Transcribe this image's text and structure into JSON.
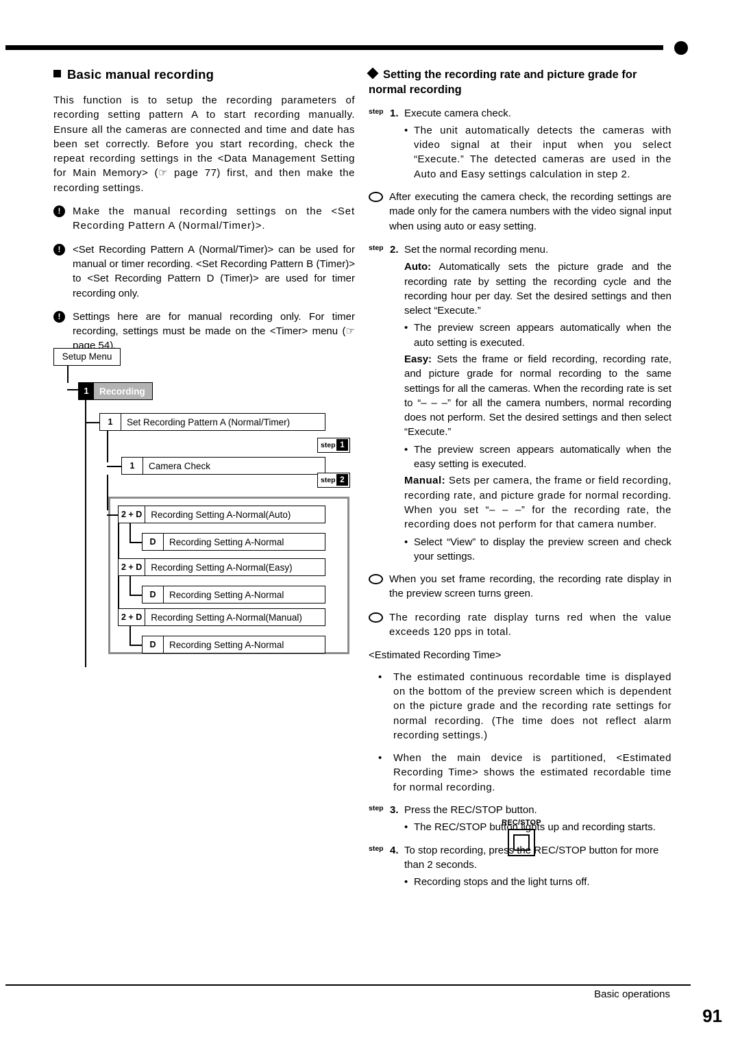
{
  "left": {
    "section_title": "Basic manual recording",
    "intro": "This function is to setup the recording parameters of recording setting pattern A to start recording manually. Ensure all the cameras are connected and time and date has been set correctly.  Before you start recording, check the repeat recording settings in the <Data Management Setting for Main Memory> (☞ page 77) first, and then make the recording settings.",
    "notes": [
      "Make the manual recording settings on the <Set Recording Pattern A (Normal/Timer)>.",
      "<Set Recording Pattern A (Normal/Timer)> can be used for manual or timer recording. <Set Recording Pattern B (Timer)> to <Set Recording Pattern D (Timer)> are used for timer recording only.",
      "Settings here are for manual recording only. For timer recording, settings must be made on the <Timer> menu (☞ page 54)."
    ],
    "diagram": {
      "setup_menu": "Setup Menu",
      "recording_tag": "1",
      "recording_label": "Recording",
      "rows": [
        {
          "tag": "1",
          "label": "Set Recording Pattern A (Normal/Timer)"
        },
        {
          "tag": "1",
          "label": "Camera Check"
        },
        {
          "tag": "2 + D",
          "label": "Recording Setting A-Normal(Auto)"
        },
        {
          "tag": "D",
          "label": "Recording Setting A-Normal"
        },
        {
          "tag": "2 + D",
          "label": "Recording Setting A-Normal(Easy)"
        },
        {
          "tag": "D",
          "label": "Recording Setting A-Normal"
        },
        {
          "tag": "2 + D",
          "label": "Recording Setting A-Normal(Manual)"
        },
        {
          "tag": "D",
          "label": "Recording Setting A-Normal"
        }
      ],
      "step_tags": [
        {
          "word": "step",
          "num": "1"
        },
        {
          "word": "step",
          "num": "2"
        }
      ]
    }
  },
  "right": {
    "section_title": "Setting the recording rate and picture grade for normal recording",
    "step1": {
      "tag": "step",
      "num": "1.",
      "text": "Execute camera check."
    },
    "step1_sub": "The unit automatically detects the cameras with video signal at their input when you select “Execute.” The detected cameras are used in the Auto and Easy settings calculation in step 2.",
    "hint1": "After executing the camera check, the recording settings are made only for the camera numbers with the video signal input when using auto or easy setting.",
    "step2": {
      "tag": "step",
      "num": "2.",
      "text": "Set the normal recording menu."
    },
    "auto_label": "Auto:",
    "auto_text": " Automatically sets the picture grade and the recording rate by setting the recording cycle and the recording hour per day. Set the desired settings and then select “Execute.”",
    "auto_sub": "The preview screen appears automatically when the auto setting is executed.",
    "easy_label": "Easy:",
    "easy_text": " Sets the frame or field recording, recording rate, and picture grade for normal recording to the same settings for all the cameras. When the recording rate is set to “– – –” for all the camera numbers, normal recording does not perform.  Set the desired settings and then select “Execute.”",
    "easy_sub": "The preview screen appears automatically when the easy setting is executed.",
    "manual_label": "Manual:",
    "manual_text": " Sets per camera, the frame or field recording, recording rate, and picture grade for normal recording. When you set “– – –” for the recording rate, the recording does not perform for that camera number.",
    "manual_sub": "Select “View” to display the preview screen and check your settings.",
    "hint2": "When you set frame recording, the recording rate display in the preview screen turns green.",
    "hint3": "The recording rate display turns red when the value exceeds 120 pps in total.",
    "estimated_title": "<Estimated Recording Time>",
    "estimated_items": [
      "The estimated continuous recordable time is displayed on the bottom of the preview screen which is dependent on the picture grade and the recording rate settings for normal recording. (The time does not reflect alarm recording settings.)",
      "When the main device is partitioned, <Estimated Recording Time> shows the estimated recordable time for normal recording."
    ],
    "step3": {
      "tag": "step",
      "num": "3.",
      "text": "Press the REC/STOP button."
    },
    "step3_sub": "The REC/STOP button lights up and recording starts.",
    "step4": {
      "tag": "step",
      "num": "4.",
      "text": "To stop recording, press the REC/STOP button for more than 2 seconds."
    },
    "step4_sub": "Recording stops and the light turns off.",
    "recstop_caption": "REC/STOP"
  },
  "footer": {
    "text": "Basic operations",
    "page": "91"
  }
}
